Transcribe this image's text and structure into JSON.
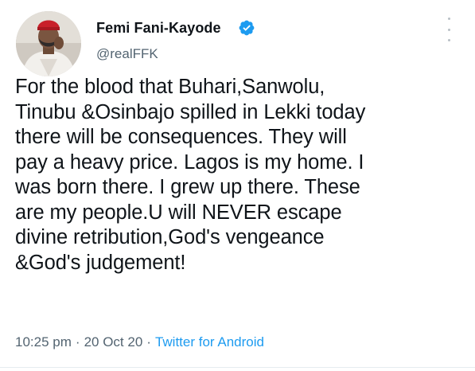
{
  "author": {
    "name": "Femi Fani-Kayode",
    "handle": "@realFFK",
    "verified_icon": "verified-badge-icon",
    "avatar_icon": "profile-photo"
  },
  "tweet": {
    "text": "For the blood that Buhari,Sanwolu,\nTinubu &Osinbajo spilled in Lekki today\nthere will be consequences. They will\npay a heavy price. Lagos is my home. I\nwas born there. I grew up there. These\nare my people.U will NEVER escape\ndivine retribution,God's vengeance\n&God's judgement!"
  },
  "meta": {
    "time": "10:25 pm",
    "separator": "·",
    "date": "20 Oct 20",
    "source": "Twitter for Android"
  },
  "colors": {
    "text": "#0f1419",
    "secondary": "#536471",
    "link": "#1d9bf0",
    "verified": "#1d9bf0"
  }
}
